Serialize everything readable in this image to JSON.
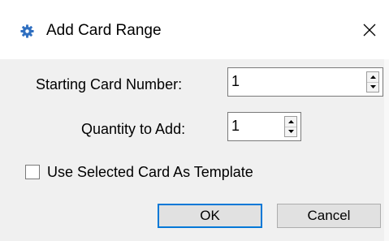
{
  "window": {
    "title": "Add Card Range",
    "icon": "gear-icon",
    "close_icon": "close-icon"
  },
  "form": {
    "starting_label": "Starting Card Number:",
    "starting_value": "1",
    "quantity_label": "Quantity to Add:",
    "quantity_value": "1",
    "template_checkbox_label": "Use Selected Card As Template",
    "template_checked": false
  },
  "buttons": {
    "ok_label": "OK",
    "cancel_label": "Cancel"
  },
  "colors": {
    "default_button_border": "#0078d7",
    "icon_blue": "#2f6fc0"
  }
}
